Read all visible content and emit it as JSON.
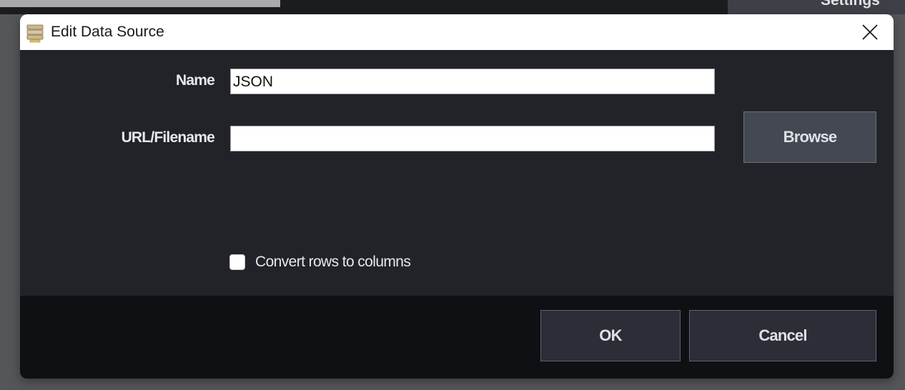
{
  "background": {
    "tab_label": "Settings"
  },
  "dialog": {
    "title": "Edit Data Source",
    "title_icon": "database-icon",
    "close_icon": "close-icon",
    "fields": {
      "name_label": "Name",
      "name_value": "JSON",
      "url_label": "URL/Filename",
      "url_value": "",
      "browse_label": "Browse"
    },
    "options": {
      "convert_rows_label": "Convert rows to columns",
      "convert_rows_checked": false
    },
    "footer": {
      "ok_label": "OK",
      "cancel_label": "Cancel"
    }
  },
  "colors": {
    "dialog_bg": "#212328",
    "footer_bg": "#0e1014",
    "button_bg": "#2b2e36",
    "browse_bg": "#444852",
    "text": "#e7e8ec"
  }
}
